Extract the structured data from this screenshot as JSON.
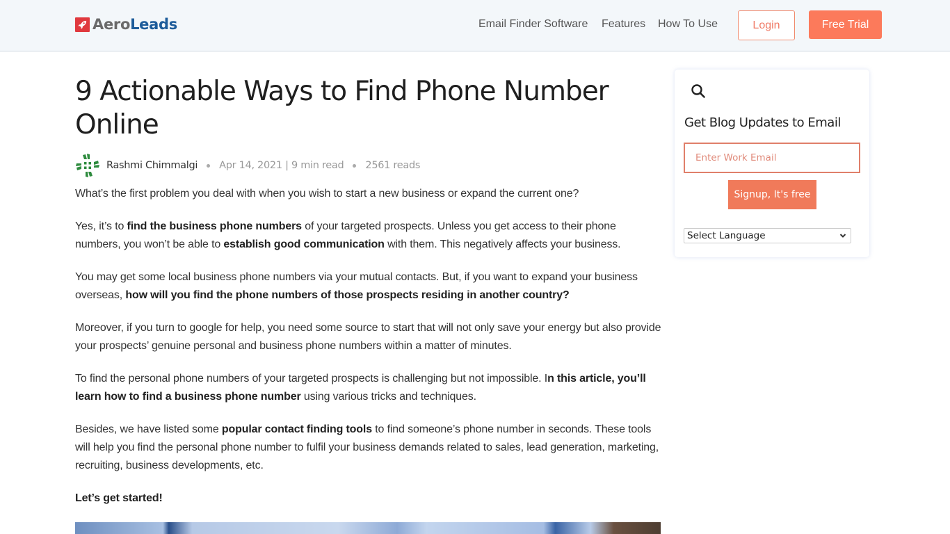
{
  "header": {
    "logo": {
      "part1": "Aero",
      "part2": "Leads",
      "icon": "rocket-icon",
      "brand_color": "#1d5c9a",
      "badge_color": "#e0393e"
    },
    "nav": [
      {
        "label": "Email Finder Software"
      },
      {
        "label": "Features"
      },
      {
        "label": "How To Use"
      }
    ],
    "login_label": "Login",
    "trial_label": "Free Trial",
    "accent_color": "#fc7a5b"
  },
  "article": {
    "title": "9 Actionable Ways to Find Phone Number Online",
    "author": "Rashmi Chimmalgi",
    "date_readtime": "Apr 14, 2021 | 9 min read",
    "reads": "2561 reads",
    "paragraphs": [
      [
        {
          "t": "What’s the first problem you deal with when you wish to start a new business or expand the current one?"
        }
      ],
      [
        {
          "t": "Yes, it’s to "
        },
        {
          "t": "find the business phone numbers",
          "b": true
        },
        {
          "t": " of your targeted prospects. Unless you get access to their phone numbers, you won’t be able to "
        },
        {
          "t": "establish good communication",
          "b": true
        },
        {
          "t": " with them. This negatively affects your business."
        }
      ],
      [
        {
          "t": "You may get some local business phone numbers via your mutual contacts. But, if you want to expand your business overseas, "
        },
        {
          "t": "how will you find the phone numbers of those prospects residing in another country?",
          "b": true
        }
      ],
      [
        {
          "t": "Moreover, if you turn to google for help, you need some source to start that will not only save your energy but also provide your prospects’ genuine personal and business phone numbers within a matter of minutes."
        }
      ],
      [
        {
          "t": "To find the personal phone numbers of your targeted prospects is challenging but not impossible. I"
        },
        {
          "t": "n this article, you’ll learn how to find a business phone number",
          "b": true
        },
        {
          "t": " using various tricks and techniques."
        }
      ],
      [
        {
          "t": "Besides, we have listed some "
        },
        {
          "t": "popular contact finding tools",
          "b": true
        },
        {
          "t": " to find someone’s phone number in seconds. These tools will help you find the personal phone number to fulfil your business demands related to sales, lead generation, marketing, recruiting, business developments, etc."
        }
      ],
      [
        {
          "t": "Let’s get started!",
          "b": true
        }
      ]
    ]
  },
  "sidebar": {
    "search_icon": "search-icon",
    "title": "Get Blog Updates to Email",
    "email_placeholder": "Enter Work Email",
    "signup_label": "Signup, It's free",
    "language_selected": "Select Language"
  }
}
